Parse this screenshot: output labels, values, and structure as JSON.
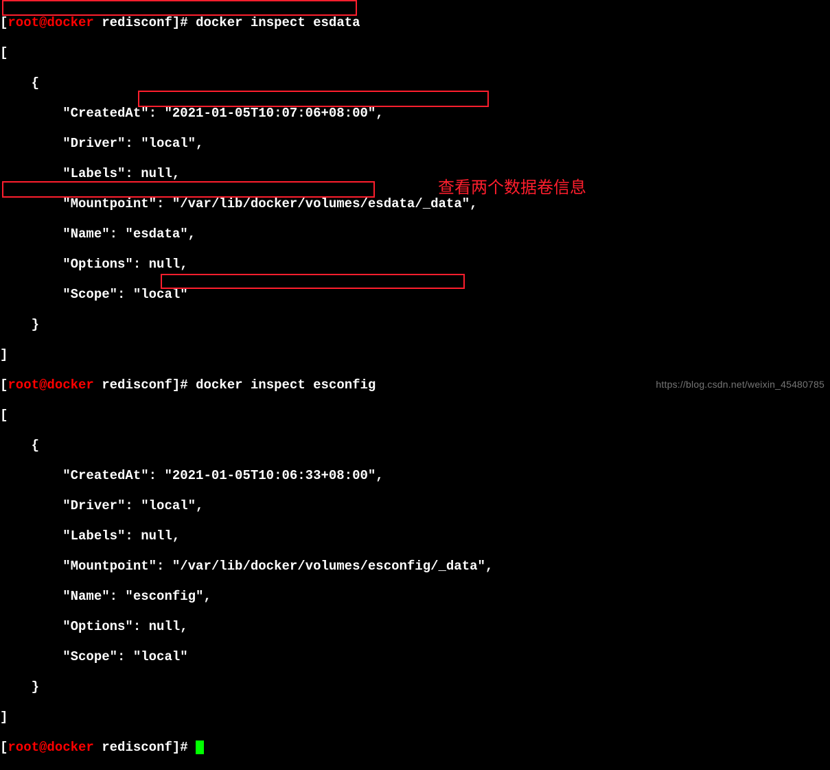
{
  "prompt": {
    "open": "[",
    "user": "root",
    "at": "@",
    "host": "docker",
    "space": " ",
    "path": "redisconf",
    "close": "]",
    "hash": "# "
  },
  "block1": {
    "cmd": "docker inspect esdata",
    "l0": "[",
    "l1": "    {",
    "l2": "        \"CreatedAt\": \"2021-01-05T10:07:06+08:00\",",
    "l3": "        \"Driver\": \"local\",",
    "l4": "        \"Labels\": null,",
    "l5_a": "        \"Mountpoint",
    "l5_b": "\": \"/var/lib/docker/volumes/esdata/_data\",",
    "l6": "        \"Name\": \"esdata\",",
    "l7": "        \"Options\": null,",
    "l8": "        \"Scope\": \"local\"",
    "l9": "    }",
    "l10": "]"
  },
  "block2": {
    "cmd": "docker inspect esconfig",
    "l0": "[",
    "l1": "    {",
    "l2": "        \"CreatedAt\": \"2021-01-05T10:06:33+08:00\",",
    "l3": "        \"Driver\": \"local\",",
    "l4": "        \"Labels\": null,",
    "l5_a": "        \"Mountpoint\": ",
    "l5_b": "\"/var/lib/docker/volumes/esconfig/_data\",",
    "l6": "        \"Name\": \"esconfig\",",
    "l7": "        \"Options\": null,",
    "l8": "        \"Scope\": \"local\"",
    "l9": "    }",
    "l10": "]"
  },
  "annotation": "查看两个数据卷信息",
  "watermark": "https://blog.csdn.net/weixin_45480785"
}
